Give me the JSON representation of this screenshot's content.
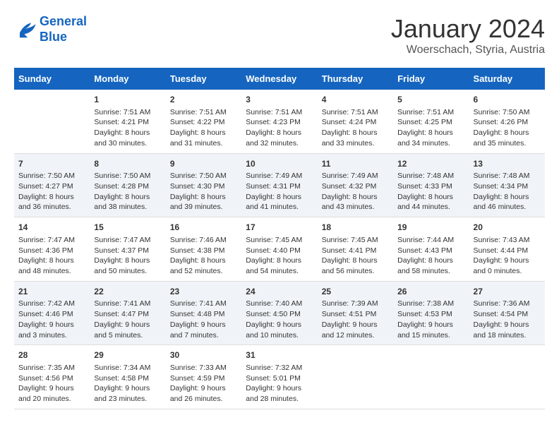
{
  "header": {
    "logo_line1": "General",
    "logo_line2": "Blue",
    "month_title": "January 2024",
    "location": "Woerschach, Styria, Austria"
  },
  "days_of_week": [
    "Sunday",
    "Monday",
    "Tuesday",
    "Wednesday",
    "Thursday",
    "Friday",
    "Saturday"
  ],
  "weeks": [
    [
      {
        "num": "",
        "sunrise": "",
        "sunset": "",
        "daylight": ""
      },
      {
        "num": "1",
        "sunrise": "Sunrise: 7:51 AM",
        "sunset": "Sunset: 4:21 PM",
        "daylight": "Daylight: 8 hours and 30 minutes."
      },
      {
        "num": "2",
        "sunrise": "Sunrise: 7:51 AM",
        "sunset": "Sunset: 4:22 PM",
        "daylight": "Daylight: 8 hours and 31 minutes."
      },
      {
        "num": "3",
        "sunrise": "Sunrise: 7:51 AM",
        "sunset": "Sunset: 4:23 PM",
        "daylight": "Daylight: 8 hours and 32 minutes."
      },
      {
        "num": "4",
        "sunrise": "Sunrise: 7:51 AM",
        "sunset": "Sunset: 4:24 PM",
        "daylight": "Daylight: 8 hours and 33 minutes."
      },
      {
        "num": "5",
        "sunrise": "Sunrise: 7:51 AM",
        "sunset": "Sunset: 4:25 PM",
        "daylight": "Daylight: 8 hours and 34 minutes."
      },
      {
        "num": "6",
        "sunrise": "Sunrise: 7:50 AM",
        "sunset": "Sunset: 4:26 PM",
        "daylight": "Daylight: 8 hours and 35 minutes."
      }
    ],
    [
      {
        "num": "7",
        "sunrise": "Sunrise: 7:50 AM",
        "sunset": "Sunset: 4:27 PM",
        "daylight": "Daylight: 8 hours and 36 minutes."
      },
      {
        "num": "8",
        "sunrise": "Sunrise: 7:50 AM",
        "sunset": "Sunset: 4:28 PM",
        "daylight": "Daylight: 8 hours and 38 minutes."
      },
      {
        "num": "9",
        "sunrise": "Sunrise: 7:50 AM",
        "sunset": "Sunset: 4:30 PM",
        "daylight": "Daylight: 8 hours and 39 minutes."
      },
      {
        "num": "10",
        "sunrise": "Sunrise: 7:49 AM",
        "sunset": "Sunset: 4:31 PM",
        "daylight": "Daylight: 8 hours and 41 minutes."
      },
      {
        "num": "11",
        "sunrise": "Sunrise: 7:49 AM",
        "sunset": "Sunset: 4:32 PM",
        "daylight": "Daylight: 8 hours and 43 minutes."
      },
      {
        "num": "12",
        "sunrise": "Sunrise: 7:48 AM",
        "sunset": "Sunset: 4:33 PM",
        "daylight": "Daylight: 8 hours and 44 minutes."
      },
      {
        "num": "13",
        "sunrise": "Sunrise: 7:48 AM",
        "sunset": "Sunset: 4:34 PM",
        "daylight": "Daylight: 8 hours and 46 minutes."
      }
    ],
    [
      {
        "num": "14",
        "sunrise": "Sunrise: 7:47 AM",
        "sunset": "Sunset: 4:36 PM",
        "daylight": "Daylight: 8 hours and 48 minutes."
      },
      {
        "num": "15",
        "sunrise": "Sunrise: 7:47 AM",
        "sunset": "Sunset: 4:37 PM",
        "daylight": "Daylight: 8 hours and 50 minutes."
      },
      {
        "num": "16",
        "sunrise": "Sunrise: 7:46 AM",
        "sunset": "Sunset: 4:38 PM",
        "daylight": "Daylight: 8 hours and 52 minutes."
      },
      {
        "num": "17",
        "sunrise": "Sunrise: 7:45 AM",
        "sunset": "Sunset: 4:40 PM",
        "daylight": "Daylight: 8 hours and 54 minutes."
      },
      {
        "num": "18",
        "sunrise": "Sunrise: 7:45 AM",
        "sunset": "Sunset: 4:41 PM",
        "daylight": "Daylight: 8 hours and 56 minutes."
      },
      {
        "num": "19",
        "sunrise": "Sunrise: 7:44 AM",
        "sunset": "Sunset: 4:43 PM",
        "daylight": "Daylight: 8 hours and 58 minutes."
      },
      {
        "num": "20",
        "sunrise": "Sunrise: 7:43 AM",
        "sunset": "Sunset: 4:44 PM",
        "daylight": "Daylight: 9 hours and 0 minutes."
      }
    ],
    [
      {
        "num": "21",
        "sunrise": "Sunrise: 7:42 AM",
        "sunset": "Sunset: 4:46 PM",
        "daylight": "Daylight: 9 hours and 3 minutes."
      },
      {
        "num": "22",
        "sunrise": "Sunrise: 7:41 AM",
        "sunset": "Sunset: 4:47 PM",
        "daylight": "Daylight: 9 hours and 5 minutes."
      },
      {
        "num": "23",
        "sunrise": "Sunrise: 7:41 AM",
        "sunset": "Sunset: 4:48 PM",
        "daylight": "Daylight: 9 hours and 7 minutes."
      },
      {
        "num": "24",
        "sunrise": "Sunrise: 7:40 AM",
        "sunset": "Sunset: 4:50 PM",
        "daylight": "Daylight: 9 hours and 10 minutes."
      },
      {
        "num": "25",
        "sunrise": "Sunrise: 7:39 AM",
        "sunset": "Sunset: 4:51 PM",
        "daylight": "Daylight: 9 hours and 12 minutes."
      },
      {
        "num": "26",
        "sunrise": "Sunrise: 7:38 AM",
        "sunset": "Sunset: 4:53 PM",
        "daylight": "Daylight: 9 hours and 15 minutes."
      },
      {
        "num": "27",
        "sunrise": "Sunrise: 7:36 AM",
        "sunset": "Sunset: 4:54 PM",
        "daylight": "Daylight: 9 hours and 18 minutes."
      }
    ],
    [
      {
        "num": "28",
        "sunrise": "Sunrise: 7:35 AM",
        "sunset": "Sunset: 4:56 PM",
        "daylight": "Daylight: 9 hours and 20 minutes."
      },
      {
        "num": "29",
        "sunrise": "Sunrise: 7:34 AM",
        "sunset": "Sunset: 4:58 PM",
        "daylight": "Daylight: 9 hours and 23 minutes."
      },
      {
        "num": "30",
        "sunrise": "Sunrise: 7:33 AM",
        "sunset": "Sunset: 4:59 PM",
        "daylight": "Daylight: 9 hours and 26 minutes."
      },
      {
        "num": "31",
        "sunrise": "Sunrise: 7:32 AM",
        "sunset": "Sunset: 5:01 PM",
        "daylight": "Daylight: 9 hours and 28 minutes."
      },
      {
        "num": "",
        "sunrise": "",
        "sunset": "",
        "daylight": ""
      },
      {
        "num": "",
        "sunrise": "",
        "sunset": "",
        "daylight": ""
      },
      {
        "num": "",
        "sunrise": "",
        "sunset": "",
        "daylight": ""
      }
    ]
  ]
}
